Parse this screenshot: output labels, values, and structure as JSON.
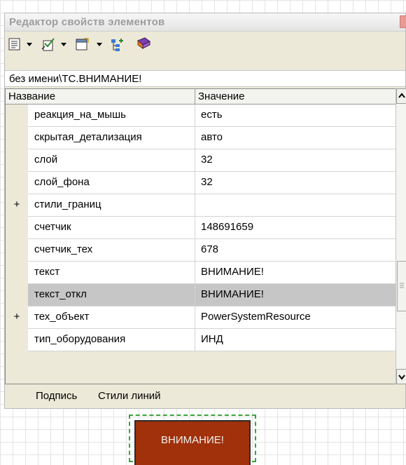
{
  "window": {
    "title": "Редактор свойств элементов"
  },
  "toolbar": {
    "icons": [
      "properties-icon",
      "check-icon",
      "document-icon",
      "tree-add-icon",
      "book-icon"
    ]
  },
  "path": "без имени\\ТС.ВНИМАНИЕ!",
  "grid": {
    "columns": [
      "Название",
      "Значение"
    ],
    "rows": [
      {
        "expander": "",
        "name": "реакция_на_мышь",
        "value": "есть",
        "selected": false
      },
      {
        "expander": "",
        "name": "скрытая_детализация",
        "value": "авто",
        "selected": false
      },
      {
        "expander": "",
        "name": "слой",
        "value": "32",
        "selected": false
      },
      {
        "expander": "",
        "name": "слой_фона",
        "value": "32",
        "selected": false
      },
      {
        "expander": "+",
        "name": "стили_границ",
        "value": "",
        "selected": false
      },
      {
        "expander": "",
        "name": "счетчик",
        "value": "148691659",
        "selected": false
      },
      {
        "expander": "",
        "name": "счетчик_тех",
        "value": "678",
        "selected": false
      },
      {
        "expander": "",
        "name": "текст",
        "value": "ВНИМАНИЕ!",
        "selected": false
      },
      {
        "expander": "",
        "name": "текст_откл",
        "value": "ВНИМАНИЕ!",
        "selected": true
      },
      {
        "expander": "+",
        "name": "тех_объект",
        "value": "PowerSystemResource",
        "selected": false
      },
      {
        "expander": "",
        "name": "тип_оборудования",
        "value": "ИНД",
        "selected": false
      }
    ]
  },
  "tabs": [
    "Подпись",
    "Стили линий"
  ],
  "canvas": {
    "element_label": "ВНИМАНИЕ!"
  },
  "colors": {
    "selected_row": "#c6c6c6",
    "panel_bg": "#ece9d8",
    "warning_fill": "#a0310a",
    "selection_dash": "#3aa33a"
  }
}
